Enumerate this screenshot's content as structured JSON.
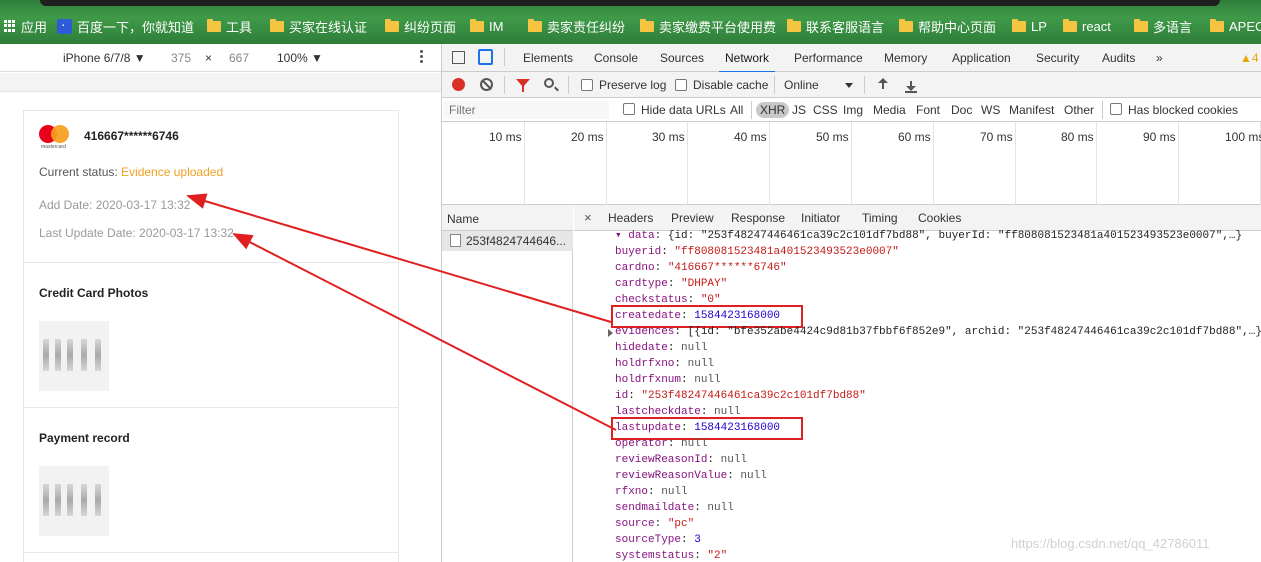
{
  "bookmarks": [
    {
      "label": "应用",
      "icon": "apps-icon"
    },
    {
      "label": "百度一下，你就知道",
      "icon": "baidu-icon"
    },
    {
      "label": "工具",
      "icon": "folder-icon"
    },
    {
      "label": "买家在线认证",
      "icon": "folder-icon"
    },
    {
      "label": "纠纷页面",
      "icon": "folder-icon"
    },
    {
      "label": "IM",
      "icon": "folder-icon"
    },
    {
      "label": "卖家责任纠纷",
      "icon": "folder-icon"
    },
    {
      "label": "卖家缴费平台使用费",
      "icon": "folder-icon"
    },
    {
      "label": "联系客服语言",
      "icon": "folder-icon"
    },
    {
      "label": "帮助中心页面",
      "icon": "folder-icon"
    },
    {
      "label": "LP",
      "icon": "folder-icon"
    },
    {
      "label": "react",
      "icon": "folder-icon"
    },
    {
      "label": "多语言",
      "icon": "folder-icon"
    },
    {
      "label": "APEC",
      "icon": "folder-icon"
    }
  ],
  "device_toolbar": {
    "device": "iPhone 6/7/8 ▼",
    "width": "375",
    "times": "×",
    "height": "667",
    "zoom": "100% ▼"
  },
  "card": {
    "card_number": "416667******6746",
    "brand_label": "mastercard",
    "status_label": "Current status: ",
    "status_value": "Evidence uploaded",
    "add_date": "Add Date: 2020-03-17 13:32",
    "last_update": "Last Update Date: 2020-03-17 13:32",
    "credit_card_photos_title": "Credit Card Photos",
    "payment_record_title": "Payment record"
  },
  "devtools": {
    "tabs": [
      "Elements",
      "Console",
      "Sources",
      "Network",
      "Performance",
      "Memory",
      "Application",
      "Security",
      "Audits",
      "»"
    ],
    "active_tab": "Network",
    "warning_count": "4",
    "toolbar": {
      "preserve_log": "Preserve log",
      "disable_cache": "Disable cache",
      "throttling": "Online"
    },
    "filter": {
      "placeholder": "Filter",
      "hide_data_urls": "Hide data URLs",
      "types": [
        "All",
        "XHR",
        "JS",
        "CSS",
        "Img",
        "Media",
        "Font",
        "Doc",
        "WS",
        "Manifest",
        "Other"
      ],
      "active_type": "XHR",
      "has_blocked_cookies": "Has blocked cookies"
    },
    "timeline_ticks": [
      "10 ms",
      "20 ms",
      "30 ms",
      "40 ms",
      "50 ms",
      "60 ms",
      "70 ms",
      "80 ms",
      "90 ms",
      "100 ms"
    ],
    "name_header": "Name",
    "request_name": "253f4824744646...",
    "detail_close": "×",
    "detail_tabs": [
      "Headers",
      "Preview",
      "Response",
      "Initiator",
      "Timing",
      "Cookies"
    ],
    "json_lines": [
      {
        "k": "▾ data",
        "v": ": {id: \"253f48247446461ca39c2c101df7bd88\", buyerId: \"ff808081523481a401523493523e0007\",…}",
        "t": "p"
      },
      {
        "k": "buyerid",
        "v": "\"ff808081523481a401523493523e0007\"",
        "t": "s"
      },
      {
        "k": "cardno",
        "v": "\"416667******6746\"",
        "t": "s"
      },
      {
        "k": "cardtype",
        "v": "\"DHPAY\"",
        "t": "s"
      },
      {
        "k": "checkstatus",
        "v": "\"0\"",
        "t": "s"
      },
      {
        "k": "createdate",
        "v": "1584423168000",
        "t": "n"
      },
      {
        "k": "evidences",
        "v": "[{id: \"bfe352abe4424c9d81b37fbbf6f852e9\", archid: \"253f48247446461ca39c2c101df7bd88\",…}",
        "t": "p"
      },
      {
        "k": "hidedate",
        "v": "null",
        "t": "null"
      },
      {
        "k": "holdrfxno",
        "v": "null",
        "t": "null"
      },
      {
        "k": "holdrfxnum",
        "v": "null",
        "t": "null"
      },
      {
        "k": "id",
        "v": "\"253f48247446461ca39c2c101df7bd88\"",
        "t": "s"
      },
      {
        "k": "lastcheckdate",
        "v": "null",
        "t": "null"
      },
      {
        "k": "lastupdate",
        "v": "1584423168000",
        "t": "n"
      },
      {
        "k": "operator",
        "v": "null",
        "t": "null"
      },
      {
        "k": "reviewReasonId",
        "v": "null",
        "t": "null"
      },
      {
        "k": "reviewReasonValue",
        "v": "null",
        "t": "null"
      },
      {
        "k": "rfxno",
        "v": "null",
        "t": "null"
      },
      {
        "k": "sendmaildate",
        "v": "null",
        "t": "null"
      },
      {
        "k": "source",
        "v": "\"pc\"",
        "t": "s"
      },
      {
        "k": "sourceType",
        "v": "3",
        "t": "n"
      },
      {
        "k": "systemstatus",
        "v": "\"2\"",
        "t": "s"
      }
    ],
    "highlighted_keys": [
      "createdate",
      "lastupdate"
    ]
  },
  "annotation_color": "#e02020",
  "watermark": "https://blog.csdn.net/qq_42786011"
}
